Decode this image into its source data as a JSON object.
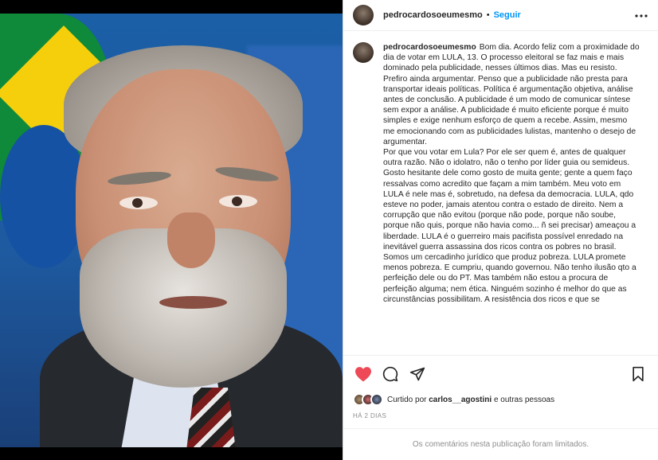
{
  "post": {
    "username": "pedrocardosoeumesmo",
    "separator": "•",
    "follow_label": "Seguir",
    "more_icon": "more-horizontal-icon"
  },
  "caption": {
    "username": "pedrocardosoeumesmo",
    "paragraph1": "Bom dia. Acordo feliz com a proximidade do dia de votar em LULA, 13. O processo eleitoral se faz mais e mais dominado pela publicidade, nesses últimos dias. Mas eu resisto. Prefiro ainda argumentar. Penso que a publicidade não presta para transportar ideais políticas. Política é argumentação objetiva, análise antes de conclusão. A publicidade é um modo de comunicar síntese sem expor a análise. A publicidade é muito eficiente porque é muito simples e exige nenhum esforço de quem a recebe. Assim, mesmo me emocionando com as publicidades lulistas, mantenho o desejo de argumentar.",
    "paragraph2": "Por que vou votar em Lula? Por ele ser quem é, antes de qualquer outra razão. Não o idolatro, não o tenho por líder guia ou semideus. Gosto hesitante dele como gosto de muita gente; gente a quem faço ressalvas como acredito que façam a mim também. Meu voto em LULA é nele mas é, sobretudo, na defesa da democracia. LULA, qdo esteve no poder, jamais atentou contra o estado de direito. Nem a corrupção que não evitou (porque não pode, porque não soube, porque não quis, porque não havia como... ñ sei precisar) ameaçou a liberdade. LULA é o guerreiro mais pacifista possível enredado na inevitável guerra assassina dos ricos contra os pobres no brasil. Somos um cercadinho jurídico que produz pobreza. LULA promete menos pobreza. E cumpriu, quando governou. Não tenho ilusão qto a perfeição dele ou do PT. Mas também não estou a procura de perfeição alguma; nem ética. Ninguém sozinho é melhor do que as circunstâncias possibilitam. A resistência dos ricos e que se"
  },
  "actions": {
    "like_icon": "heart-filled-icon",
    "comment_icon": "comment-icon",
    "share_icon": "share-icon",
    "save_icon": "bookmark-icon",
    "like_color": "#ed4956"
  },
  "likes": {
    "prefix": "Curtido por",
    "user": "carlos__agostini",
    "suffix": "e outras pessoas"
  },
  "timestamp": "HÁ 2 DIAS",
  "comments_limited": "Os comentários nesta publicação foram limitados."
}
